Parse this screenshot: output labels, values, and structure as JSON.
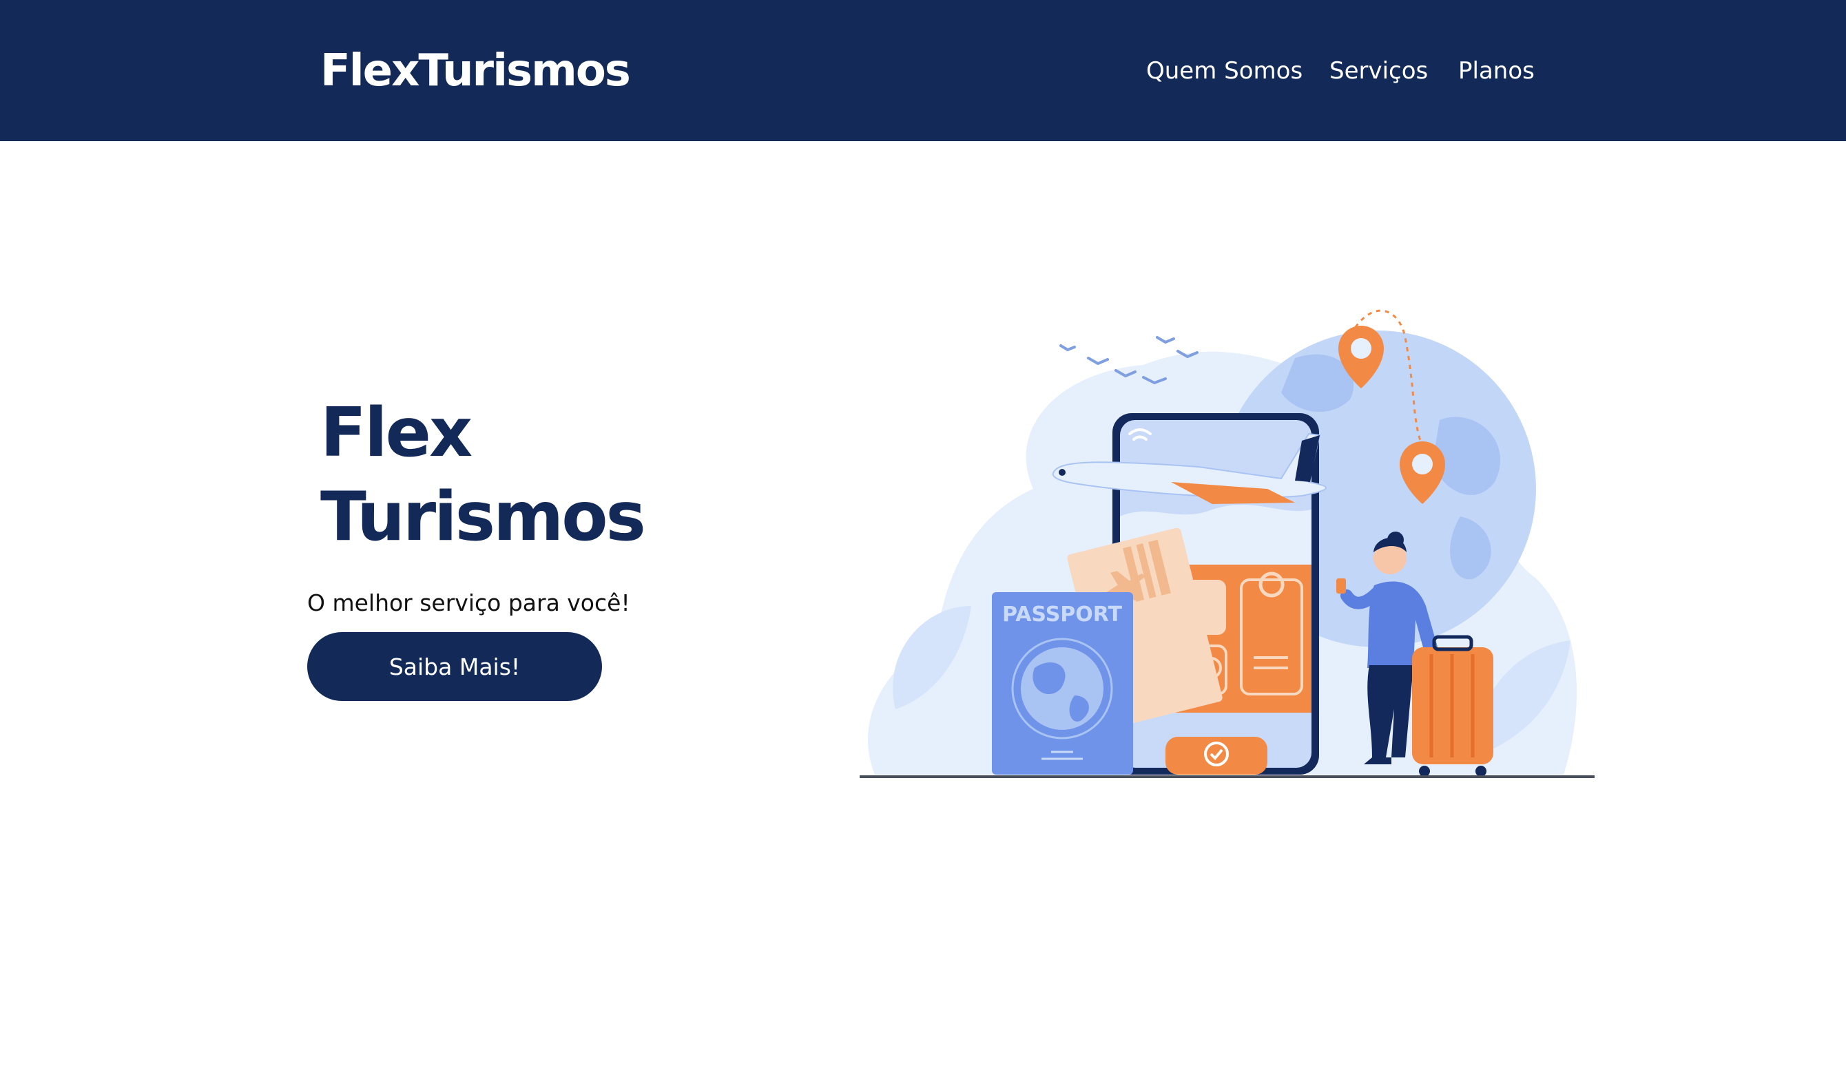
{
  "header": {
    "brand": "FlexTurismos",
    "nav": [
      {
        "label": "Quem Somos"
      },
      {
        "label": "Serviços"
      },
      {
        "label": "Planos"
      }
    ]
  },
  "hero": {
    "title_line1": "Flex",
    "title_line2": "Turismos",
    "subtitle": "O melhor serviço para você!",
    "cta_label": "Saiba Mais!"
  },
  "illustration": {
    "passport_label": "PASSPORT"
  },
  "colors": {
    "navy": "#132a58",
    "orange": "#f28a45",
    "light_blue": "#e6effc",
    "mid_blue": "#a9c3f3",
    "passport_blue": "#6f93e8"
  }
}
